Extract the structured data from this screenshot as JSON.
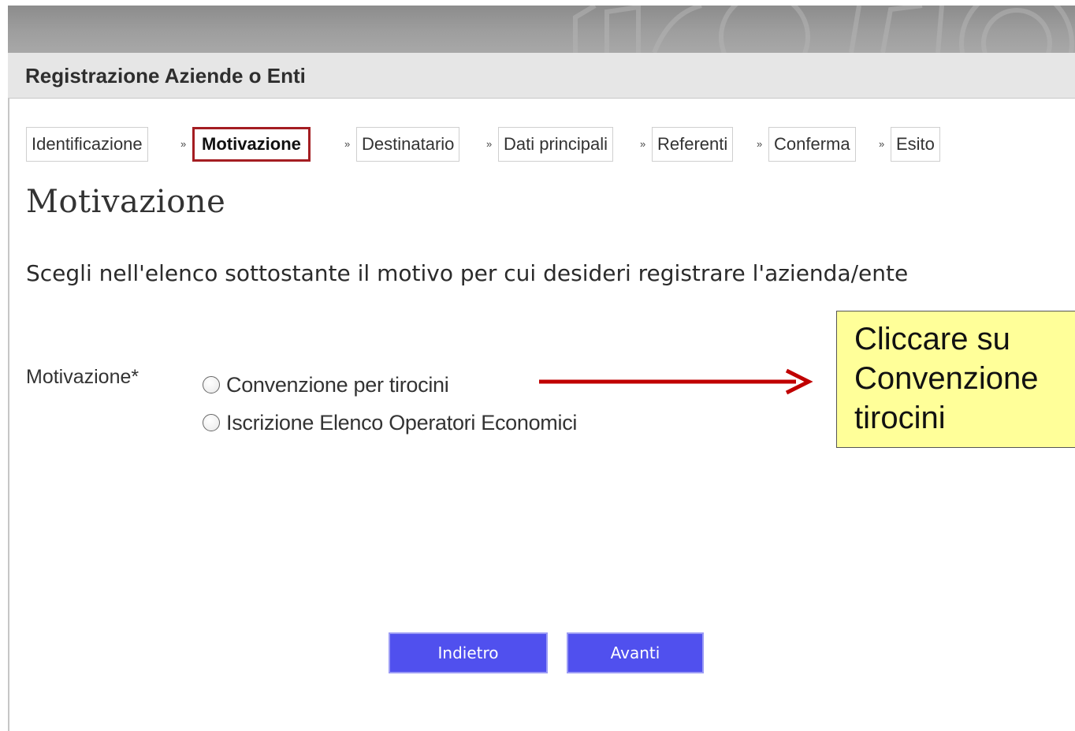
{
  "header": {
    "title": "Registrazione Aziende o Enti"
  },
  "steps": [
    {
      "label": "Identificazione"
    },
    {
      "label": "Motivazione",
      "active": true
    },
    {
      "label": "Destinatario"
    },
    {
      "label": "Dati principali"
    },
    {
      "label": "Referenti"
    },
    {
      "label": "Conferma"
    },
    {
      "label": "Esito"
    }
  ],
  "step_separator": "»",
  "main": {
    "heading": "Motivazione",
    "instruction": "Scegli nell'elenco sottostante il motivo per cui desideri registrare l'azienda/ente",
    "field_label": "Motivazione*",
    "options": [
      {
        "label": "Convenzione per tirocini",
        "selected": false
      },
      {
        "label": "Iscrizione Elenco Operatori Economici",
        "selected": false
      }
    ]
  },
  "callout": {
    "lines": [
      "Cliccare su",
      "Convenzione",
      "tirocini"
    ]
  },
  "buttons": {
    "back_label": "Indietro",
    "next_label": "Avanti"
  },
  "colors": {
    "active_step_border": "#a41d22",
    "button_bg": "#5050ee",
    "callout_bg": "#ffff99",
    "arrow": "#c00000"
  }
}
